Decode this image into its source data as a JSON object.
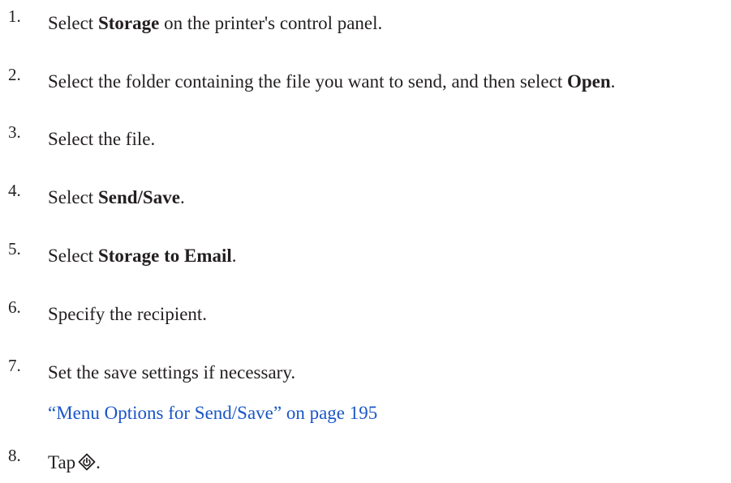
{
  "steps": [
    {
      "number": "1.",
      "pre": "Select ",
      "bold": "Storage",
      "post": " on the printer's control panel."
    },
    {
      "number": "2.",
      "pre": "Select the folder containing the file you want to send, and then select ",
      "bold": "Open",
      "post": "."
    },
    {
      "number": "3.",
      "text": "Select the file."
    },
    {
      "number": "4.",
      "pre": "Select ",
      "bold": "Send/Save",
      "post": "."
    },
    {
      "number": "5.",
      "pre": "Select ",
      "bold": "Storage to Email",
      "post": "."
    },
    {
      "number": "6.",
      "text": "Specify the recipient."
    },
    {
      "number": "7.",
      "text": "Set the save settings if necessary.",
      "link": "“Menu Options for Send/Save” on page 195"
    },
    {
      "number": "8.",
      "pre": "Tap",
      "icon": "start-button-icon",
      "post": "."
    }
  ],
  "colors": {
    "text": "#231f20",
    "link": "#1a56c8"
  }
}
